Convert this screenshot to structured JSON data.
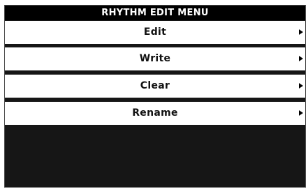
{
  "menu": {
    "title": "RHYTHM EDIT MENU",
    "items": [
      {
        "label": "Edit",
        "icon": "chevron-right-icon"
      },
      {
        "label": "Write",
        "icon": "chevron-right-icon"
      },
      {
        "label": "Clear",
        "icon": "chevron-right-icon"
      },
      {
        "label": "Rename",
        "icon": "chevron-right-icon"
      }
    ]
  },
  "colors": {
    "screen_background": "#161616",
    "title_background": "#000000",
    "title_text": "#ffffff",
    "item_background": "#ffffff",
    "item_text": "#111111"
  }
}
